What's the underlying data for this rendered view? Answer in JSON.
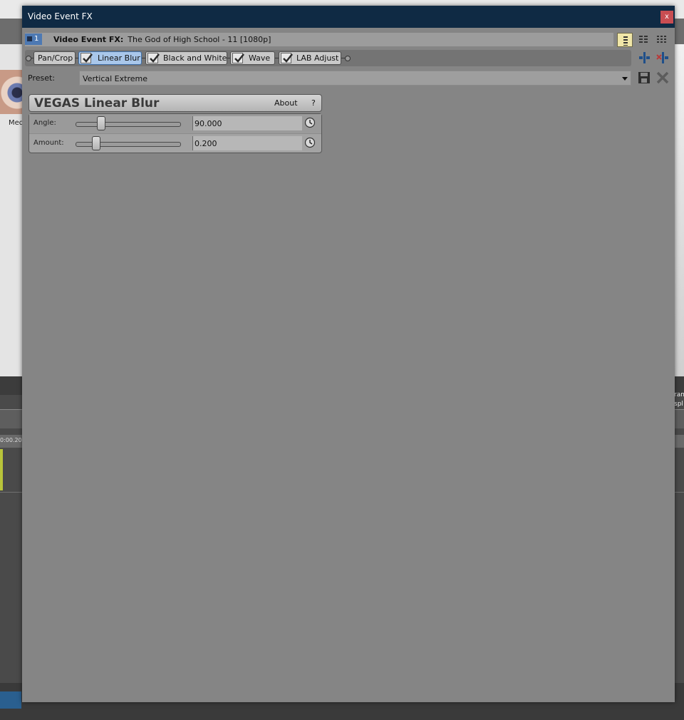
{
  "background": {
    "left_label": "Med",
    "ruler_time": "0:00.20",
    "right_text": [
      "ram",
      "spl"
    ]
  },
  "dialog": {
    "title": "Video Event FX",
    "close_label": "x",
    "header": {
      "badge_number": "1",
      "label": "Video Event FX:",
      "media_name": "The God of High School - 11 [1080p]"
    },
    "fx_chain": [
      {
        "label": "Pan/Crop",
        "has_checkbox": false,
        "active": false
      },
      {
        "label": "Linear Blur",
        "has_checkbox": true,
        "active": true
      },
      {
        "label": "Black and White",
        "has_checkbox": true,
        "active": false
      },
      {
        "label": "Wave",
        "has_checkbox": true,
        "active": false
      },
      {
        "label": "LAB Adjust",
        "has_checkbox": true,
        "active": false
      }
    ],
    "preset": {
      "label": "Preset:",
      "value": "Vertical Extreme"
    },
    "plugin": {
      "title": "VEGAS Linear Blur",
      "about_label": "About",
      "help_label": "?",
      "params": [
        {
          "label": "Angle:",
          "value": "90.000"
        },
        {
          "label": "Amount:",
          "value": "0.200"
        }
      ]
    },
    "icons": {
      "view_modes": [
        "view-list-icon",
        "view-columns-icon",
        "view-grid-icon"
      ],
      "side": [
        "insert-fx-icon",
        "remove-fx-icon",
        "save-preset-icon",
        "delete-preset-icon"
      ],
      "param": "animate-keyframe-icon"
    }
  }
}
